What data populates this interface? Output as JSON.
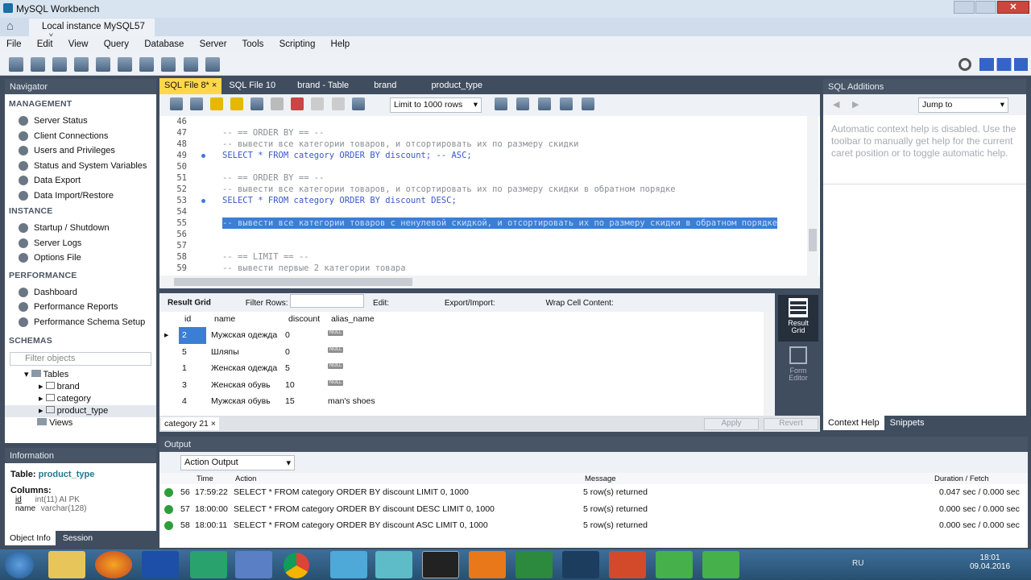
{
  "window": {
    "title": "MySQL Workbench",
    "tab": "Local instance MySQL57"
  },
  "menu": [
    "File",
    "Edit",
    "View",
    "Query",
    "Database",
    "Server",
    "Tools",
    "Scripting",
    "Help"
  ],
  "navigator": {
    "title": "Navigator",
    "management": {
      "title": "MANAGEMENT",
      "items": [
        "Server Status",
        "Client Connections",
        "Users and Privileges",
        "Status and System Variables",
        "Data Export",
        "Data Import/Restore"
      ]
    },
    "instance": {
      "title": "INSTANCE",
      "items": [
        "Startup / Shutdown",
        "Server Logs",
        "Options File"
      ]
    },
    "performance": {
      "title": "PERFORMANCE",
      "items": [
        "Dashboard",
        "Performance Reports",
        "Performance Schema Setup"
      ]
    },
    "schemas": {
      "title": "SCHEMAS",
      "filter_placeholder": "Filter objects",
      "tree": [
        "Tables",
        "brand",
        "category",
        "product_type",
        "Views"
      ]
    }
  },
  "information": {
    "title": "Information",
    "table_label": "Table:",
    "table_name": "product_type",
    "columns_label": "Columns:",
    "columns": [
      {
        "name": "id",
        "type": "int(11) AI PK"
      },
      {
        "name": "name",
        "type": "varchar(128)"
      }
    ],
    "tabs": [
      "Object Info",
      "Session"
    ]
  },
  "editor_tabs": [
    "SQL File 8*",
    "SQL File 10",
    "brand - Table",
    "brand",
    "product_type"
  ],
  "editor_toolbar": {
    "limit": "Limit to 1000 rows"
  },
  "code": [
    {
      "n": "46",
      "t": ""
    },
    {
      "n": "47",
      "t": "-- == ORDER BY == --",
      "c": "cm"
    },
    {
      "n": "48",
      "t": "-- вывести все категории товаров, и отсортировать их по размеру скидки",
      "c": "cm"
    },
    {
      "n": "49",
      "t": "SELECT * FROM category ORDER BY discount; -- ASC;",
      "c": "sql1"
    },
    {
      "n": "50",
      "t": ""
    },
    {
      "n": "51",
      "t": "-- == ORDER BY == --",
      "c": "cm"
    },
    {
      "n": "52",
      "t": "-- вывести все категории товаров, и отсортировать их по размеру скидки в обратном порядке",
      "c": "cm"
    },
    {
      "n": "53",
      "t": "SELECT * FROM category ORDER BY discount DESC;",
      "c": "sql2"
    },
    {
      "n": "54",
      "t": ""
    },
    {
      "n": "55",
      "t": "-- вывести все категории товаров с ненулевой скидкой, и отсортировать их по размеру скидки в обратном порядке",
      "c": "sel"
    },
    {
      "n": "56",
      "t": ""
    },
    {
      "n": "57",
      "t": ""
    },
    {
      "n": "58",
      "t": "-- == LIMIT == --",
      "c": "cm"
    },
    {
      "n": "59",
      "t": "-- вывести первые 2 категории товара",
      "c": "cm"
    }
  ],
  "result": {
    "toolbar": {
      "grid": "Result Grid",
      "filter": "Filter Rows:",
      "edit": "Edit:",
      "export": "Export/Import:",
      "wrap": "Wrap Cell Content:"
    },
    "headers": [
      "id",
      "name",
      "discount",
      "alias_name"
    ],
    "rows": [
      [
        "2",
        "Мужская одежда",
        "0",
        "NULL"
      ],
      [
        "5",
        "Шляпы",
        "0",
        "NULL"
      ],
      [
        "1",
        "Женская одежда",
        "5",
        "NULL"
      ],
      [
        "3",
        "Женская обувь",
        "10",
        "NULL"
      ],
      [
        "4",
        "Мужская обувь",
        "15",
        "man's shoes"
      ]
    ],
    "tab": "category 21",
    "apply": "Apply",
    "revert": "Revert",
    "side": [
      "Result Grid",
      "Form Editor"
    ]
  },
  "sql_additions": {
    "title": "SQL Additions",
    "jump": "Jump to",
    "help": "Automatic context help is disabled. Use the toolbar to manually get help for the current caret position or to toggle automatic help.",
    "tabs": [
      "Context Help",
      "Snippets"
    ]
  },
  "output": {
    "title": "Output",
    "mode": "Action Output",
    "headers": [
      "Time",
      "Action",
      "Message",
      "Duration / Fetch"
    ],
    "rows": [
      {
        "n": "56",
        "time": "17:59:22",
        "action": "SELECT * FROM category ORDER BY discount LIMIT 0, 1000",
        "msg": "5 row(s) returned",
        "dur": "0.047 sec / 0.000 sec"
      },
      {
        "n": "57",
        "time": "18:00:00",
        "action": "SELECT * FROM category ORDER BY discount DESC LIMIT 0, 1000",
        "msg": "5 row(s) returned",
        "dur": "0.000 sec / 0.000 sec"
      },
      {
        "n": "58",
        "time": "18:00:11",
        "action": "SELECT * FROM category ORDER BY discount ASC LIMIT 0, 1000",
        "msg": "5 row(s) returned",
        "dur": "0.000 sec / 0.000 sec"
      }
    ]
  },
  "taskbar": {
    "lang": "RU",
    "time": "18:01",
    "date": "09.04.2016"
  }
}
